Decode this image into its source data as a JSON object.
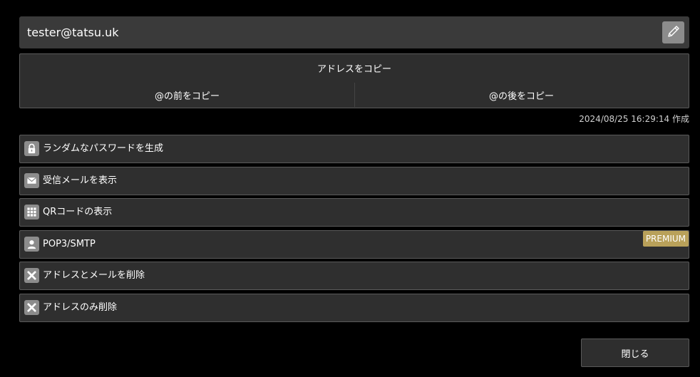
{
  "address": {
    "value": "tester@tatsu.uk",
    "edit_icon": "pencil-icon"
  },
  "copy": {
    "copy_address": "アドレスをコピー",
    "copy_before_at": "@の前をコピー",
    "copy_after_at": "@の後をコピー"
  },
  "created": {
    "timestamp": "2024/08/25 16:29:14",
    "suffix": "作成"
  },
  "menu": {
    "items": [
      {
        "label": "ランダムなパスワードを生成",
        "icon": "lock-icon"
      },
      {
        "label": "受信メールを表示",
        "icon": "mail-icon"
      },
      {
        "label": "QRコードの表示",
        "icon": "qr-grid-icon"
      },
      {
        "label": "POP3/SMTP",
        "icon": "user-icon",
        "badge": "PREMIUM"
      },
      {
        "label": "アドレスとメールを削除",
        "icon": "close-icon"
      },
      {
        "label": "アドレスのみ削除",
        "icon": "close-icon"
      }
    ]
  },
  "footer": {
    "close_label": "閉じる"
  },
  "colors": {
    "background": "#000000",
    "panel": "#2f2f2f",
    "address_bar": "#3a3a3a",
    "icon_bg": "#8c8c8c",
    "premium": "#b9a15a"
  }
}
